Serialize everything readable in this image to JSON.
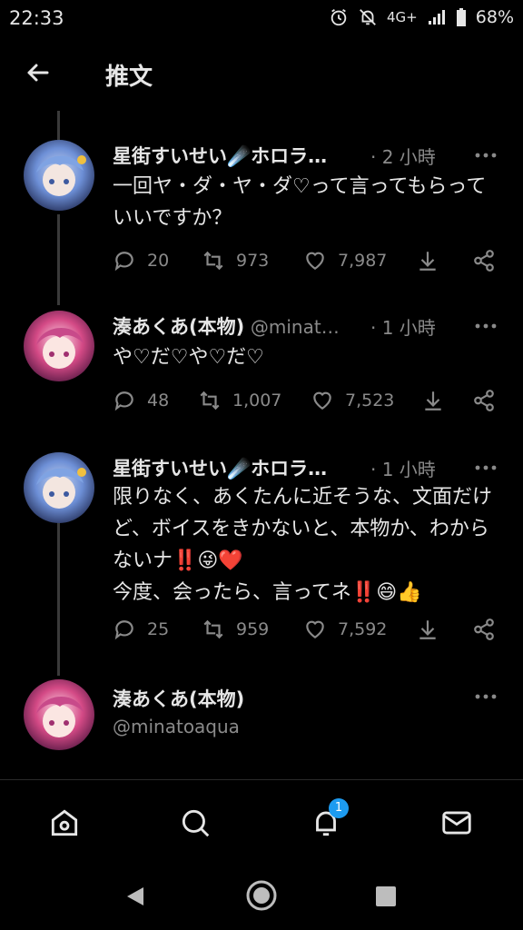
{
  "status_bar": {
    "time": "22:33",
    "network": "4G+",
    "battery": "68%"
  },
  "header": {
    "title": "推文"
  },
  "tweets": [
    {
      "name": "星街すいせい☄️ホロラ…",
      "handle": "",
      "time": "· 2 小時",
      "text": "一回ヤ・ダ・ヤ・ダ♡って言ってもらっていいですか？",
      "replies": "20",
      "retweets": "973",
      "likes": "7,987"
    },
    {
      "name": "湊あくあ(本物)",
      "handle": "@minat…",
      "time": "· 1 小時",
      "text": "や♡だ♡や♡だ♡",
      "replies": "48",
      "retweets": "1,007",
      "likes": "7,523"
    },
    {
      "name": "星街すいせい☄️ホロラ…",
      "handle": "",
      "time": "· 1 小時",
      "text": "限りなく、あくたんに近そうな、文面だけど、ボイスをきかないと、本物か、わからないナ‼️😜❤️\n今度、会ったら、言ってネ‼️😄👍",
      "replies": "25",
      "retweets": "959",
      "likes": "7,592"
    }
  ],
  "focused_tweet": {
    "name": "湊あくあ(本物)",
    "handle": "@minatoaqua"
  },
  "bottom_nav": {
    "notifications_badge": "1"
  },
  "colors": {
    "background": "#000000",
    "accent": "#1d9bf0",
    "muted": "#8a8a8a"
  }
}
